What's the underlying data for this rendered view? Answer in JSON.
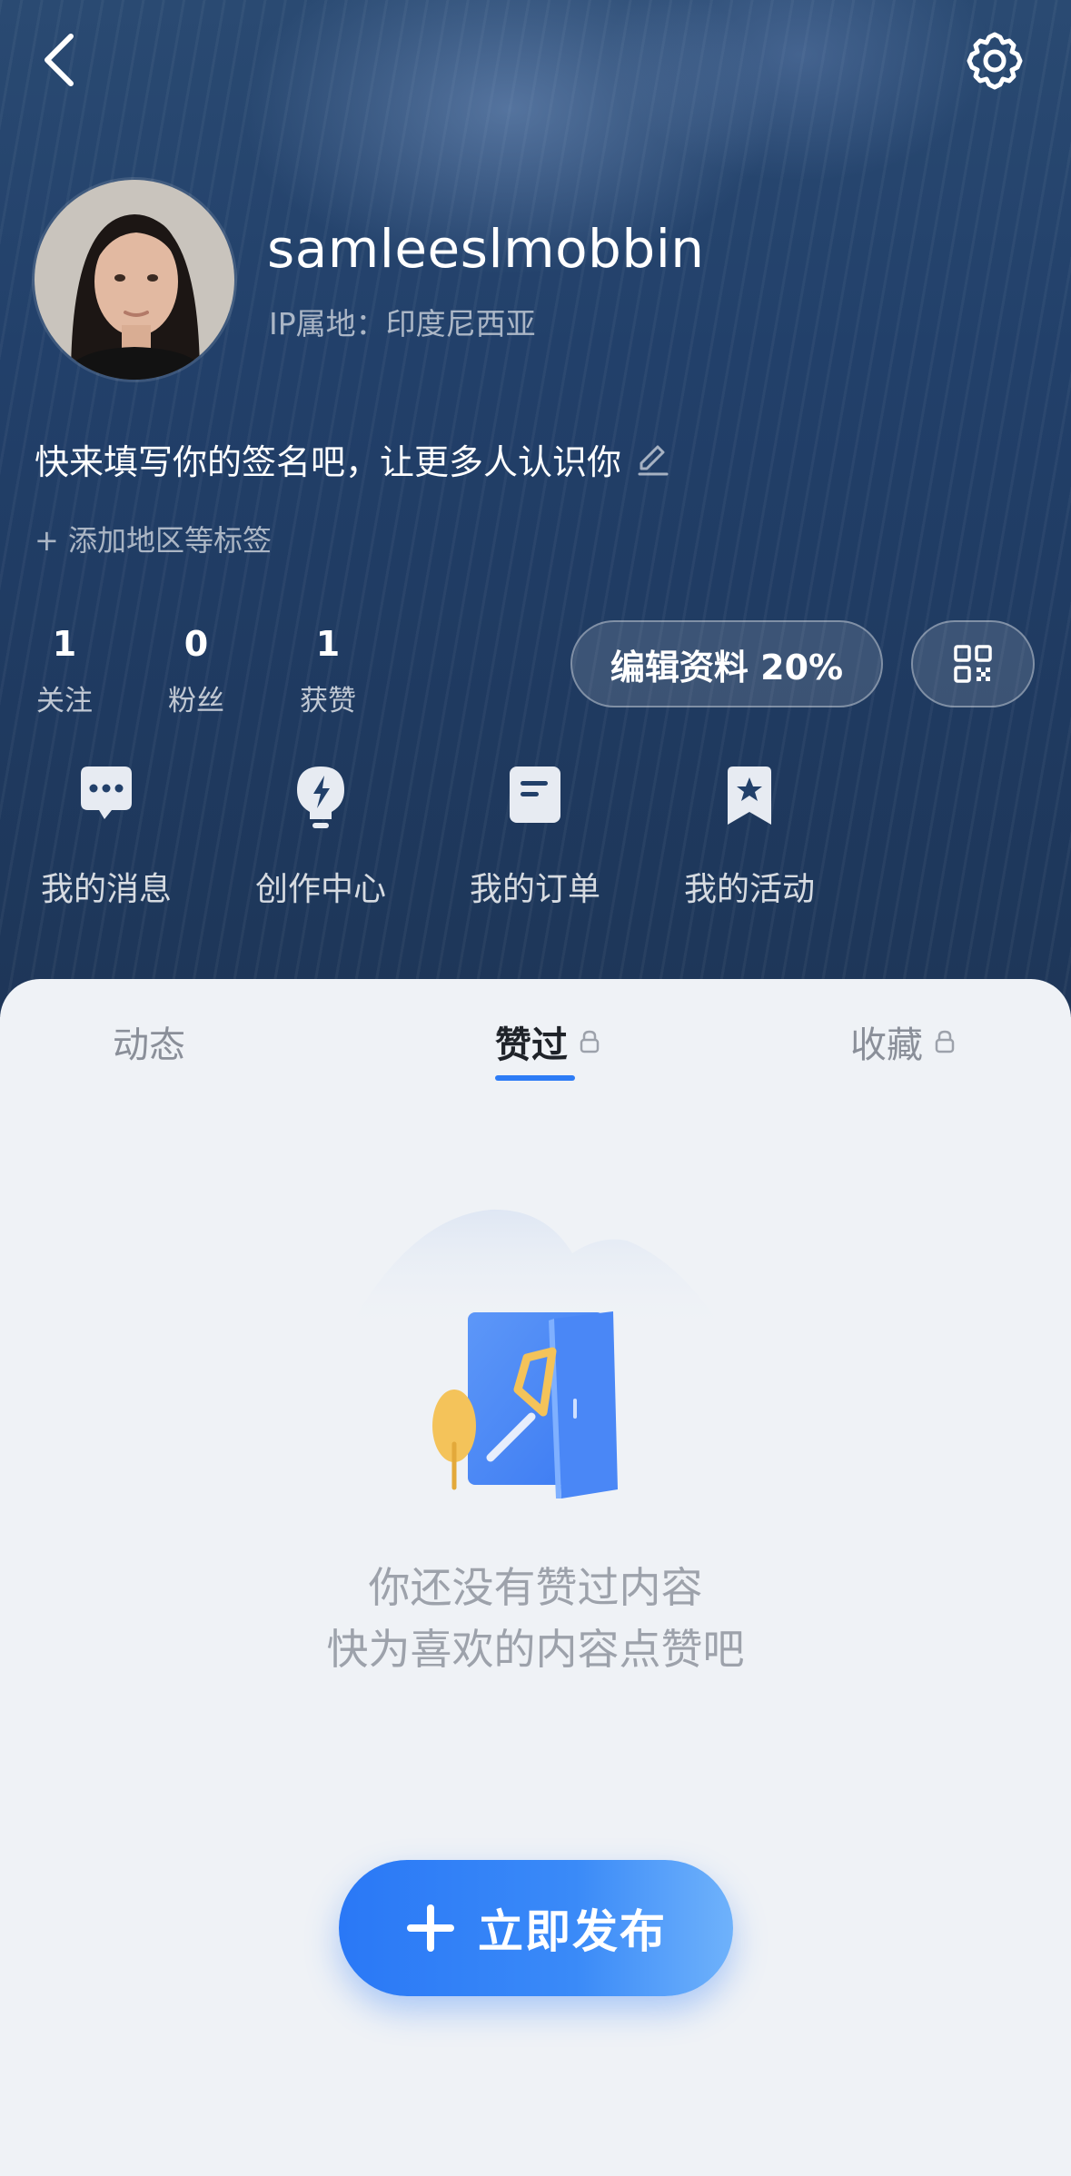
{
  "header": {
    "back_icon": "chevron-left-icon",
    "settings_icon": "gear-icon"
  },
  "profile": {
    "username": "samleeslmobbin",
    "ip_location": "IP属地：印度尼西亚",
    "bio_placeholder": "快来填写你的签名吧，让更多人认识你",
    "add_tag": "+ 添加地区等标签"
  },
  "stats": [
    {
      "count": "1",
      "label": "关注"
    },
    {
      "count": "0",
      "label": "粉丝"
    },
    {
      "count": "1",
      "label": "获赞"
    }
  ],
  "edit_profile": {
    "label": "编辑资料 20%",
    "completion_percent": 20
  },
  "quick_links": [
    {
      "label": "我的消息",
      "icon": "message-bubble-icon"
    },
    {
      "label": "创作中心",
      "icon": "lightning-bulb-icon"
    },
    {
      "label": "我的订单",
      "icon": "order-document-icon"
    },
    {
      "label": "我的活动",
      "icon": "star-bookmark-icon"
    }
  ],
  "tabs": [
    {
      "label": "动态",
      "active": false,
      "locked": false
    },
    {
      "label": "赞过",
      "active": true,
      "locked": true
    },
    {
      "label": "收藏",
      "active": false,
      "locked": true
    }
  ],
  "empty_state": {
    "line1": "你还没有赞过内容",
    "line2": "快为喜欢的内容点赞吧"
  },
  "publish_button": {
    "label": "立即发布"
  },
  "colors": {
    "accent": "#2d7cf6",
    "header_bg": "#22406a",
    "page_bg": "#eff2f6"
  }
}
